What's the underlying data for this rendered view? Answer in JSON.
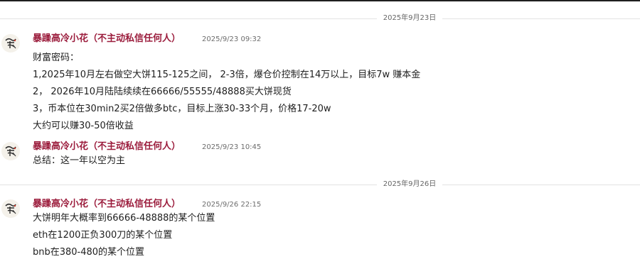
{
  "dates": [
    "2025年9月23日",
    "2025年9月26日"
  ],
  "messages": [
    {
      "sender": "暴躁高冷小花（不主动私信任何人）",
      "time": "2025/9/23 09:32",
      "lines": [
        "财富密码：",
        "1,2025年10月左右做空大饼115-125之间， 2-3倍，爆仓价控制在14万以上，目标7w  赚本金",
        "2，  2026年10月陆陆续续在66666/55555/48888买大饼现货",
        "3，币本位在30min2买2倍做多btc，目标上涨30-33个月，价格17-20w",
        "大约可以赚30-50倍收益"
      ]
    },
    {
      "sender": "暴躁高冷小花（不主动私信任何人）",
      "time": "2025/9/23 10:45",
      "lines": [
        "总结：这一年以空为主"
      ]
    },
    {
      "sender": "暴躁高冷小花（不主动私信任何人）",
      "time": "2025/9/26 22:15",
      "lines": [
        "大饼明年大概率到66666-48888的某个位置",
        "eth在1200正负300刀的某个位置",
        "bnb在380-480的某个位置"
      ]
    }
  ],
  "avatar_icon": "calligraphy-avatar-icon",
  "colors": {
    "sender": "#9b1c3c",
    "timestamp": "#6d6d6d",
    "text": "#1e1e1e",
    "separator": "#e3e3e3"
  }
}
